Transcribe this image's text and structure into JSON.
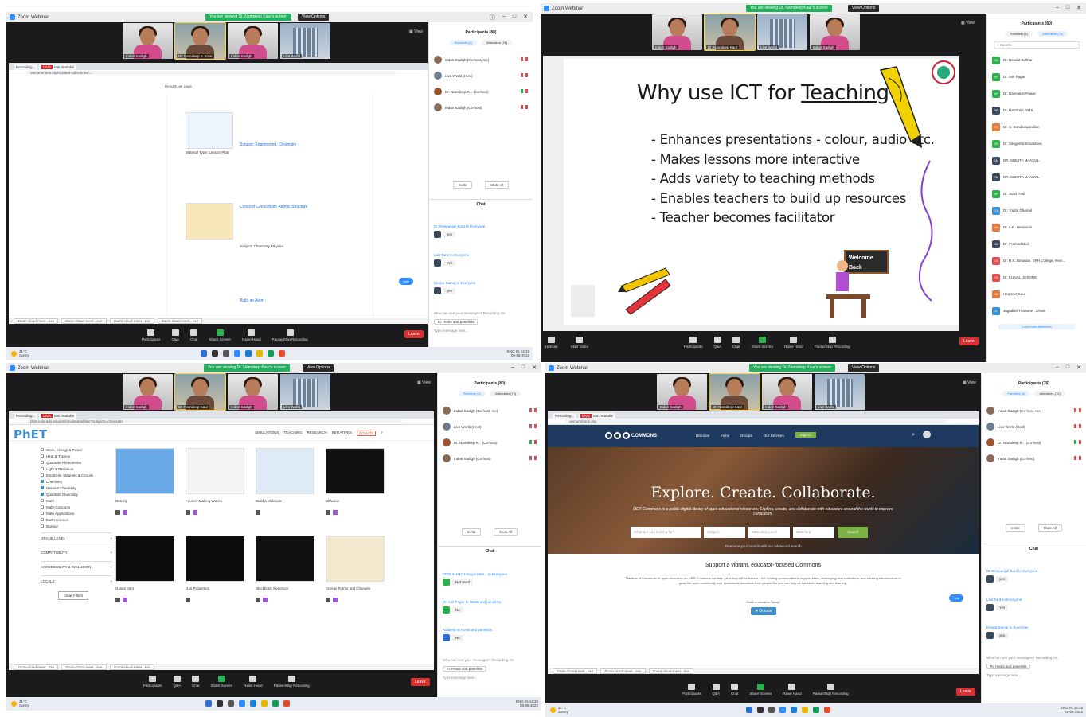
{
  "q1": {
    "app_title": "Zoom Webinar",
    "share_banner": "You are viewing Dr. Namdeep Kaur's screen",
    "view_options": "View Options",
    "videos": [
      {
        "name": "Indari Sadigh"
      },
      {
        "name": "Dr. Namdeep K. Kaur"
      },
      {
        "name": "Indari Sadigh"
      },
      {
        "name": "Live World"
      }
    ],
    "tabs": [
      "Recording...",
      "LIVE · Iam Youtube ..."
    ],
    "url": "oercommons.org/curated-collections/...",
    "results_label": "Results per page",
    "lesson1": {
      "title": "Subject: Engineering, Chemistry",
      "meta": "Material Type: Lesson Plan"
    },
    "lesson2": {
      "title": "Concord Consortium: Atomic Structure",
      "meta": "Subject: Chemistry, Physics"
    },
    "lesson3": {
      "title": "Build an Atom"
    },
    "help": "Help",
    "downloads": [
      "Zoom-cloud-meet...exe",
      "Zoom-cloud-meet...exe",
      "Zoom-cloud-meet...exe",
      "Zoom-cloud-meet...exe"
    ],
    "toolbar": [
      "Participants",
      "Q&A",
      "Chat",
      "Share Screen",
      "Raise Hand",
      "Pause/Stop Recording"
    ],
    "leave": "Leave",
    "weather": {
      "temp": "31°C",
      "cond": "Sunny"
    },
    "tray": {
      "lang": "ENG IN",
      "time": "14:19",
      "date": "06-05-2022"
    },
    "side": {
      "participants_title": "Participants (80)",
      "tab_panelists": "Panelists (4)",
      "tab_attendees": "Attendees (76)",
      "people": [
        "Indari Sadigh (Co-host, me)",
        "Live World (Host)",
        "Dr. Namdeep K... (Co-host)",
        "Indari Sadigh (Co-host)"
      ],
      "invite": "Invite",
      "mute_all": "Mute All",
      "chat_title": "Chat",
      "msgs": [
        {
          "from": "Dr. Deepanjali Bora to Everyone",
          "text": "yes"
        },
        {
          "from": "Lalit Tank to Everyone",
          "text": "Yes"
        },
        {
          "from": "Deepa Samaj to Everyone",
          "text": "yes"
        }
      ],
      "who_sees": "Who can see your messages? Recording On",
      "to": "To: Hosts and panelists",
      "placeholder": "Type message here..."
    }
  },
  "q2": {
    "app_title": "Zoom Webinar",
    "share_banner": "You are viewing Dr. Namdeep Kaur's screen",
    "view_options": "View Options",
    "videos": [
      {
        "name": "Indari Sadigh"
      },
      {
        "name": "Dr. Namdeep Kaur"
      },
      {
        "name": "Live World"
      },
      {
        "name": "Indari Sadigh"
      }
    ],
    "slide_title_pre": "Why use ICT for ",
    "slide_title_u": "Teaching",
    "slide_title_post": "?",
    "bullets": [
      "- Enhances presentations - colour, audio etc.",
      "- Makes lessons more interactive",
      "- Adds variety to teaching methods",
      "- Enables teachers to build up resources",
      "- Teacher becomes facilitator"
    ],
    "welcome_sign": "Welcome Back",
    "toolbar": [
      "Unmute",
      "Start Video",
      "Participants",
      "Q&A",
      "Chat",
      "Share Screen",
      "Raise Hand",
      "Pause/Stop Recording"
    ],
    "leave": "Leave",
    "side": {
      "participants_title": "Participants (80)",
      "tab_panelists": "Panelists (4)",
      "tab_attendees": "Attendees (76)",
      "search": "Search",
      "attendees": [
        {
          "init": "DB",
          "name": "Dr. Devdat Bulthar",
          "color": "#2bb24c"
        },
        {
          "init": "NP",
          "name": "Dr. Anil Pagar",
          "color": "#2bb24c"
        },
        {
          "init": "NP",
          "name": "Dr. Navnatish Pawar",
          "color": "#2bb24c"
        },
        {
          "init": "RP",
          "name": "Dr. RAKESH PATIL",
          "color": "#3b4a5c"
        },
        {
          "init": "DS",
          "name": "Dr. S. Sundarapandian",
          "color": "#e8793b"
        },
        {
          "init": "SS",
          "name": "Dr. Sangeeta Srivastava",
          "color": "#2bb24c"
        },
        {
          "init": "DM",
          "name": "DR. SUMITA MANDAL",
          "color": "#3b4a5c"
        },
        {
          "init": "DM",
          "name": "DR. SUMITA MANDAL",
          "color": "#3b4a5c"
        },
        {
          "init": "SP",
          "name": "Dr. Sunil Patil",
          "color": "#2bb24c"
        },
        {
          "init": "DY",
          "name": "Dr. Yogita Dhumal",
          "color": "#3d8fce"
        },
        {
          "init": "DH",
          "name": "Dr. A.R. Hemanan",
          "color": "#e8793b"
        },
        {
          "init": "DD",
          "name": "Dr. Pramod Dixit",
          "color": "#3b4a5c"
        },
        {
          "init": "DS",
          "name": "Dr. R.K. Bimwate, SPH College, Nem...",
          "color": "#e24c4c"
        },
        {
          "init": "DS",
          "name": "Dr. KUNAL DESORE",
          "color": "#e24c4c"
        },
        {
          "init": "HK",
          "name": "Harpreet Kaur",
          "color": "#e8793b"
        },
        {
          "init": "JT",
          "name": "Jagadish Tirawane , Dhule",
          "color": "#3d8fce"
        }
      ],
      "load_more": "Load more attendees"
    }
  },
  "q3": {
    "app_title": "Zoom Webinar",
    "share_banner": "You are viewing Dr. Namdeep Kaur's screen",
    "view_options": "View Options",
    "videos": [
      {
        "name": "Indari Sadigh"
      },
      {
        "name": "Dr. Namdeep Kaur"
      },
      {
        "name": "Indari Sadigh"
      },
      {
        "name": "Live World"
      }
    ],
    "url": "phet.colorado.edu/en/simulations/filter?subjects=chemistry",
    "logo": "PhET",
    "nav": [
      "SIMULATIONS",
      "TEACHING",
      "RESEARCH",
      "INITIATIVES"
    ],
    "donate": "DONATE",
    "filters": [
      {
        "label": "Work, Energy & Power",
        "on": false
      },
      {
        "label": "Heat & Thermo",
        "on": false
      },
      {
        "label": "Quantum Phenomena",
        "on": false
      },
      {
        "label": "Light & Radiation",
        "on": false
      },
      {
        "label": "Electricity, Magnets & Circuits",
        "on": false
      },
      {
        "label": "Chemistry",
        "on": true
      },
      {
        "label": "General Chemistry",
        "on": true
      },
      {
        "label": "Quantum Chemistry",
        "on": true
      },
      {
        "label": "Math",
        "on": false
      },
      {
        "label": "Math Concepts",
        "on": false
      },
      {
        "label": "Math Applications",
        "on": false
      },
      {
        "label": "Earth Science",
        "on": false
      },
      {
        "label": "Biology",
        "on": false
      }
    ],
    "sections": [
      "GRADE LEVEL",
      "COMPATIBILITY",
      "ACCESSIBILITY & INCLUSION",
      "LOCALE"
    ],
    "clear": "Clear Filters",
    "sims": [
      {
        "name": "Density",
        "bg": "#6aa9e8"
      },
      {
        "name": "Fourier: Making Waves",
        "bg": "#f5f5f5"
      },
      {
        "name": "Build a Molecule",
        "bg": "#dfeaf7"
      },
      {
        "name": "Diffusion",
        "bg": "#111111"
      },
      {
        "name": "Gases Intro",
        "bg": "#0c0c0c"
      },
      {
        "name": "Gas Properties",
        "bg": "#0c0c0c"
      },
      {
        "name": "Blackbody Spectrum",
        "bg": "#111111"
      },
      {
        "name": "Energy Forms and Changes",
        "bg": "#f3e9cf"
      }
    ],
    "toolbar": [
      "Participants",
      "Q&A",
      "Chat",
      "Share Screen",
      "Raise Hand",
      "Pause/Stop Recording"
    ],
    "leave": "Leave",
    "weather": {
      "temp": "31°C",
      "cond": "Sunny"
    },
    "tray": {
      "lang": "ENG IN",
      "time": "14:29",
      "date": "06-05-2022"
    },
    "side": {
      "participants_title": "Participants (80)",
      "tab_panelists": "Panelists (4)",
      "tab_attendees": "Attendees (76)",
      "people": [
        "Indari Sadigh (Co-host, me)",
        "Live World (Host)",
        "Dr. Namdeep K... (Co-host)",
        "Indari Sadigh (Co-host)"
      ],
      "invite": "Invite",
      "mute_all": "Mute All",
      "chat_title": "Chat",
      "msgs": [
        {
          "from": "VEDI SHAKTI Nirguli Meh... to Everyone",
          "text": "Not used"
        },
        {
          "from": "Dr. Anil Pagar to Hosts and panelists",
          "text": "No"
        },
        {
          "from": "Kuldeep to Hosts and panelists",
          "text": "No"
        }
      ],
      "who_sees": "Who can see your messages? Recording On",
      "to": "To: Hosts and panelists",
      "placeholder": "Type message here..."
    }
  },
  "q4": {
    "app_title": "Zoom Webinar",
    "share_banner": "You are viewing Dr. Namdeep Kaur's screen",
    "view_options": "View Options",
    "videos": [
      {
        "name": "Indari Sadigh"
      },
      {
        "name": "Dr. Namdeep Kaur"
      },
      {
        "name": "Indari Sadigh"
      },
      {
        "name": "Live World"
      }
    ],
    "url": "oercommons.org",
    "oer_brand": "COMMONS",
    "oer_nav": [
      "Discover",
      "Hubs",
      "Groups",
      "Our Services"
    ],
    "sign_in": "Sign In",
    "hero_title": "Explore. Create. Collaborate.",
    "hero_sub": "OER Commons is a public digital library of open educational resources. Explore, create, and collaborate with educators around the world to improve curriculum.",
    "search_ph": "What are you looking for?",
    "subject_ph": "Subject",
    "edu_ph": "Education Level",
    "std_ph": "Standard",
    "search_btn": "Search",
    "adv": "Fine tune your search with our advanced search",
    "support": "Support a vibrant, educator-focused Commons",
    "support_p": "The tens of thousands of open resources on OER Commons are free - and they will be forever - but building communities to support them, developing new collections, and creating infrastructure to grow the open community isn't. Grassroots donations from people like you can help us transform teaching and learning.",
    "make_today": "Make a donation Today!",
    "donate": "Donate",
    "help": "Help",
    "toolbar": [
      "Participants",
      "Q&A",
      "Chat",
      "Share Screen",
      "Raise Hand",
      "Pause/Stop Recording"
    ],
    "leave": "Leave",
    "weather": {
      "temp": "31°C",
      "cond": "Sunny"
    },
    "tray": {
      "lang": "ENG IN",
      "time": "14:18",
      "date": "06-05-2022"
    },
    "side": {
      "participants_title": "Participants (76)",
      "tab_panelists": "Panelists (4)",
      "tab_attendees": "Attendees (72)",
      "people": [
        "Indari Sadigh (Co-host, me)",
        "Live World (Host)",
        "Dr. Namdeep K... (Co-host)",
        "Indari Sadigh (Co-host)"
      ],
      "invite": "Invite",
      "mute_all": "Mute All",
      "chat_title": "Chat",
      "msgs": [
        {
          "from": "Dr. Deepanjali Bora to Everyone",
          "text": "yes"
        },
        {
          "from": "Lalit Tank to Everyone",
          "text": "Yes"
        },
        {
          "from": "Deepa Samaj to Everyone",
          "text": "yes"
        }
      ],
      "who_sees": "Who can see your messages? Recording On",
      "to": "To: Hosts and panelists",
      "placeholder": "Type message here..."
    }
  }
}
